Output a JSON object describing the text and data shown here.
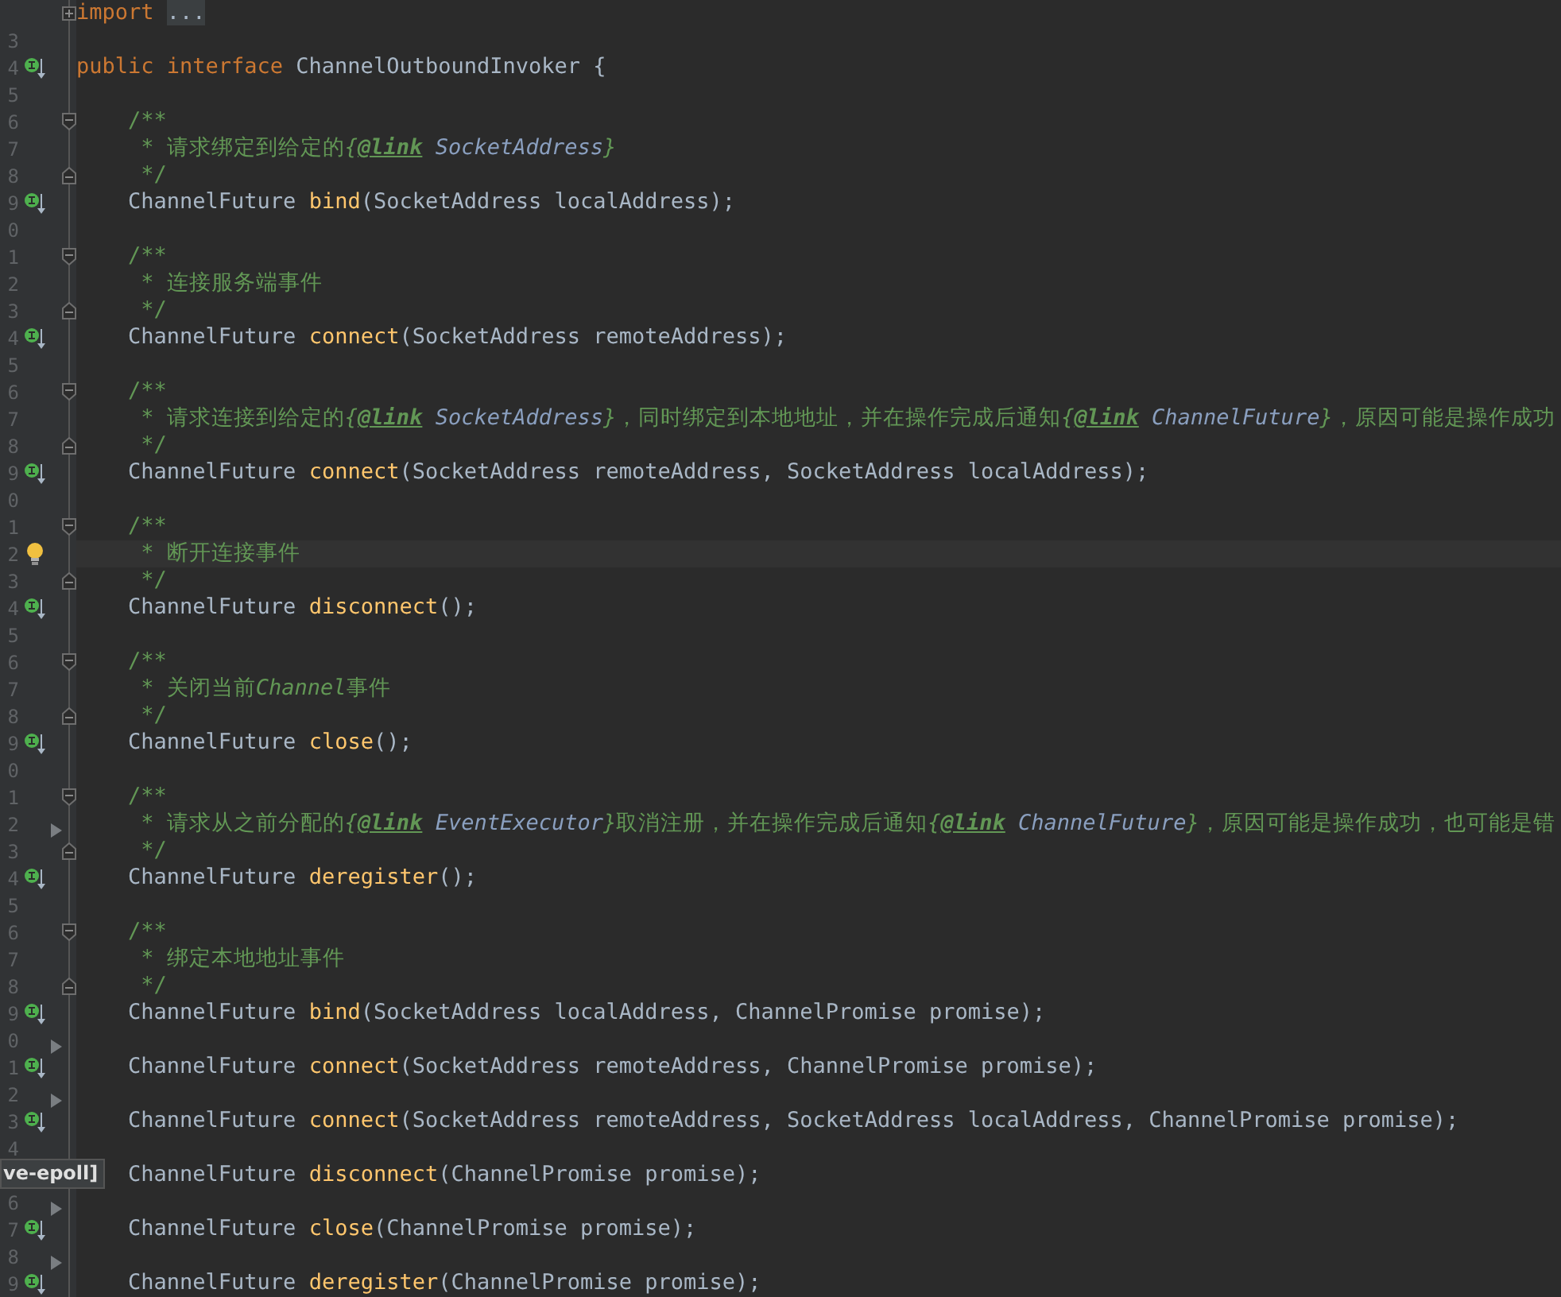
{
  "editor": {
    "lines": [
      {
        "folded": true,
        "tokens": [
          {
            "kind": "kw",
            "text": "import "
          },
          {
            "kind": "folded",
            "text": "..."
          }
        ]
      },
      {
        "number": "3"
      },
      {
        "number": "4",
        "implemented": true,
        "tokens": [
          {
            "kind": "kw",
            "text": "public interface "
          },
          {
            "kind": "plain",
            "text": "ChannelOutboundInvoker {"
          }
        ]
      },
      {
        "number": "5"
      },
      {
        "number": "6",
        "fold_start": true,
        "tokens": [
          {
            "kind": "doc",
            "text": "    /**"
          }
        ]
      },
      {
        "number": "7",
        "tokens": [
          {
            "kind": "doc",
            "text": "     * 请求绑定到给定的"
          },
          {
            "kind": "doc-em",
            "text": "{"
          },
          {
            "kind": "doc-tag",
            "text": "@link"
          },
          {
            "kind": "doc-ref",
            "text": " SocketAddress"
          },
          {
            "kind": "doc-em",
            "text": "}"
          }
        ]
      },
      {
        "number": "8",
        "fold_end": true,
        "tokens": [
          {
            "kind": "doc",
            "text": "     */"
          }
        ]
      },
      {
        "number": "9",
        "implemented": true,
        "tokens": [
          {
            "kind": "plain",
            "text": "    ChannelFuture "
          },
          {
            "kind": "method",
            "text": "bind"
          },
          {
            "kind": "plain",
            "text": "(SocketAddress localAddress);"
          }
        ]
      },
      {
        "number": "0"
      },
      {
        "number": "1",
        "fold_start": true,
        "tokens": [
          {
            "kind": "doc",
            "text": "    /**"
          }
        ]
      },
      {
        "number": "2",
        "tokens": [
          {
            "kind": "doc",
            "text": "     * 连接服务端事件"
          }
        ]
      },
      {
        "number": "3",
        "fold_end": true,
        "tokens": [
          {
            "kind": "doc",
            "text": "     */"
          }
        ]
      },
      {
        "number": "4",
        "implemented": true,
        "tokens": [
          {
            "kind": "plain",
            "text": "    ChannelFuture "
          },
          {
            "kind": "method",
            "text": "connect"
          },
          {
            "kind": "plain",
            "text": "(SocketAddress remoteAddress);"
          }
        ]
      },
      {
        "number": "5"
      },
      {
        "number": "6",
        "fold_start": true,
        "tokens": [
          {
            "kind": "doc",
            "text": "    /**"
          }
        ]
      },
      {
        "number": "7",
        "tokens": [
          {
            "kind": "doc",
            "text": "     * 请求连接到给定的"
          },
          {
            "kind": "doc-em",
            "text": "{"
          },
          {
            "kind": "doc-tag",
            "text": "@link"
          },
          {
            "kind": "doc-ref",
            "text": " SocketAddress"
          },
          {
            "kind": "doc-em",
            "text": "}"
          },
          {
            "kind": "doc",
            "text": "，同时绑定到本地地址，并在操作完成后通知"
          },
          {
            "kind": "doc-em",
            "text": "{"
          },
          {
            "kind": "doc-tag",
            "text": "@link"
          },
          {
            "kind": "doc-ref",
            "text": " ChannelFuture"
          },
          {
            "kind": "doc-em",
            "text": "}"
          },
          {
            "kind": "doc",
            "text": "，原因可能是操作成功"
          }
        ]
      },
      {
        "number": "8",
        "fold_end": true,
        "tokens": [
          {
            "kind": "doc",
            "text": "     */"
          }
        ]
      },
      {
        "number": "9",
        "implemented": true,
        "tokens": [
          {
            "kind": "plain",
            "text": "    ChannelFuture "
          },
          {
            "kind": "method",
            "text": "connect"
          },
          {
            "kind": "plain",
            "text": "(SocketAddress remoteAddress, SocketAddress localAddress);"
          }
        ]
      },
      {
        "number": "0"
      },
      {
        "number": "1",
        "fold_start": true,
        "tokens": [
          {
            "kind": "doc",
            "text": "    /**"
          }
        ]
      },
      {
        "number": "2",
        "bulb": true,
        "current": true,
        "tokens": [
          {
            "kind": "doc",
            "text": "     * 断开连接事件"
          }
        ]
      },
      {
        "number": "3",
        "fold_end": true,
        "tokens": [
          {
            "kind": "doc",
            "text": "     */"
          }
        ]
      },
      {
        "number": "4",
        "implemented": true,
        "tokens": [
          {
            "kind": "plain",
            "text": "    ChannelFuture "
          },
          {
            "kind": "method",
            "text": "disconnect"
          },
          {
            "kind": "plain",
            "text": "();"
          }
        ]
      },
      {
        "number": "5"
      },
      {
        "number": "6",
        "fold_start": true,
        "tokens": [
          {
            "kind": "doc",
            "text": "    /**"
          }
        ]
      },
      {
        "number": "7",
        "tokens": [
          {
            "kind": "doc",
            "text": "     * 关闭当前"
          },
          {
            "kind": "doc-em",
            "text": "Channel"
          },
          {
            "kind": "doc",
            "text": "事件"
          }
        ]
      },
      {
        "number": "8",
        "fold_end": true,
        "tokens": [
          {
            "kind": "doc",
            "text": "     */"
          }
        ]
      },
      {
        "number": "9",
        "implemented": true,
        "tokens": [
          {
            "kind": "plain",
            "text": "    ChannelFuture "
          },
          {
            "kind": "method",
            "text": "close"
          },
          {
            "kind": "plain",
            "text": "();"
          }
        ]
      },
      {
        "number": "0"
      },
      {
        "number": "1",
        "fold_start": true,
        "tokens": [
          {
            "kind": "doc",
            "text": "    /**"
          }
        ]
      },
      {
        "number": "2",
        "arrow": true,
        "tokens": [
          {
            "kind": "doc",
            "text": "     * 请求从之前分配的"
          },
          {
            "kind": "doc-em",
            "text": "{"
          },
          {
            "kind": "doc-tag",
            "text": "@link"
          },
          {
            "kind": "doc-ref",
            "text": " EventExecutor"
          },
          {
            "kind": "doc-em",
            "text": "}"
          },
          {
            "kind": "doc",
            "text": "取消注册，并在操作完成后通知"
          },
          {
            "kind": "doc-em",
            "text": "{"
          },
          {
            "kind": "doc-tag",
            "text": "@link"
          },
          {
            "kind": "doc-ref",
            "text": " ChannelFuture"
          },
          {
            "kind": "doc-em",
            "text": "}"
          },
          {
            "kind": "doc",
            "text": "，原因可能是操作成功，也可能是错"
          }
        ]
      },
      {
        "number": "3",
        "fold_end": true,
        "tokens": [
          {
            "kind": "doc",
            "text": "     */"
          }
        ]
      },
      {
        "number": "4",
        "implemented": true,
        "tokens": [
          {
            "kind": "plain",
            "text": "    ChannelFuture "
          },
          {
            "kind": "method",
            "text": "deregister"
          },
          {
            "kind": "plain",
            "text": "();"
          }
        ]
      },
      {
        "number": "5"
      },
      {
        "number": "6",
        "fold_start": true,
        "tokens": [
          {
            "kind": "doc",
            "text": "    /**"
          }
        ]
      },
      {
        "number": "7",
        "tokens": [
          {
            "kind": "doc",
            "text": "     * 绑定本地地址事件"
          }
        ]
      },
      {
        "number": "8",
        "fold_end": true,
        "tokens": [
          {
            "kind": "doc",
            "text": "     */"
          }
        ]
      },
      {
        "number": "9",
        "implemented": true,
        "tokens": [
          {
            "kind": "plain",
            "text": "    ChannelFuture "
          },
          {
            "kind": "method",
            "text": "bind"
          },
          {
            "kind": "plain",
            "text": "(SocketAddress localAddress, ChannelPromise promise);"
          }
        ]
      },
      {
        "number": "0",
        "arrow": true
      },
      {
        "number": "1",
        "implemented": true,
        "tokens": [
          {
            "kind": "plain",
            "text": "    ChannelFuture "
          },
          {
            "kind": "method",
            "text": "connect"
          },
          {
            "kind": "plain",
            "text": "(SocketAddress remoteAddress, ChannelPromise promise);"
          }
        ]
      },
      {
        "number": "2",
        "arrow": true
      },
      {
        "number": "3",
        "implemented": true,
        "tokens": [
          {
            "kind": "plain",
            "text": "    ChannelFuture "
          },
          {
            "kind": "method",
            "text": "connect"
          },
          {
            "kind": "plain",
            "text": "(SocketAddress remoteAddress, SocketAddress localAddress, ChannelPromise promise);"
          }
        ]
      },
      {
        "number": "4"
      },
      {
        "tooltip": "ve-epoll]",
        "tokens": [
          {
            "kind": "plain",
            "text": "    ChannelFuture "
          },
          {
            "kind": "method",
            "text": "disconnect"
          },
          {
            "kind": "plain",
            "text": "(ChannelPromise promise);"
          }
        ]
      },
      {
        "number": "6",
        "arrow": true
      },
      {
        "number": "7",
        "implemented": true,
        "tokens": [
          {
            "kind": "plain",
            "text": "    ChannelFuture "
          },
          {
            "kind": "method",
            "text": "close"
          },
          {
            "kind": "plain",
            "text": "(ChannelPromise promise);"
          }
        ]
      },
      {
        "number": "8",
        "arrow": true
      },
      {
        "number": "9",
        "implemented": true,
        "tokens": [
          {
            "kind": "plain",
            "text": "    ChannelFuture "
          },
          {
            "kind": "method",
            "text": "deregister"
          },
          {
            "kind": "plain",
            "text": "(ChannelPromise promise);"
          }
        ]
      }
    ]
  }
}
